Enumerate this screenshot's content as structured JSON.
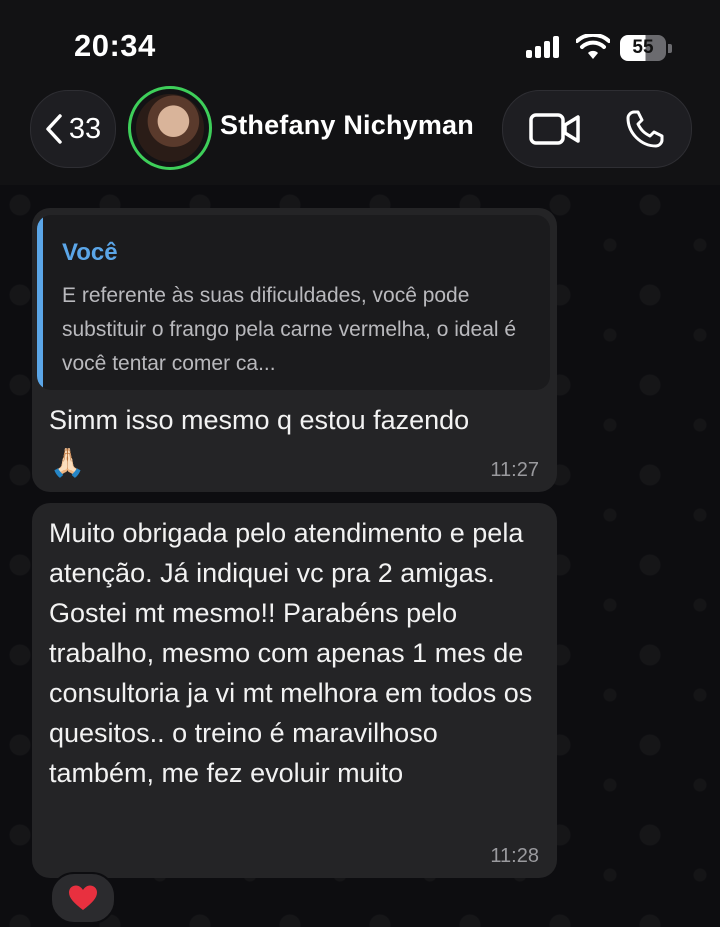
{
  "status_bar": {
    "time": "20:34",
    "battery": "55"
  },
  "header": {
    "back_count": "33",
    "contact_name": "Sthefany Nichyman"
  },
  "messages": [
    {
      "quote": {
        "author": "Você",
        "text": "E referente às suas dificuldades, você pode substituir o frango pela carne vermelha, o ideal é você tentar comer ca..."
      },
      "text": "Simm isso mesmo q estou fazendo",
      "emoji": "🙏🏻",
      "time": "11:27"
    },
    {
      "text": "Muito obrigada pelo atendimento e pela atenção. Já indiquei vc pra 2 amigas. Gostei mt mesmo!! Parabéns pelo trabalho, mesmo com apenas 1 mes de consultoria ja vi mt melhora em todos os quesitos.. o treino é maravilhoso também, me fez evoluir muito",
      "time": "11:28",
      "reaction": "heart-icon"
    }
  ],
  "colors": {
    "quote_accent": "#5ba6e8",
    "avatar_ring": "#3ecf5a",
    "reaction_heart": "#e8303f"
  }
}
